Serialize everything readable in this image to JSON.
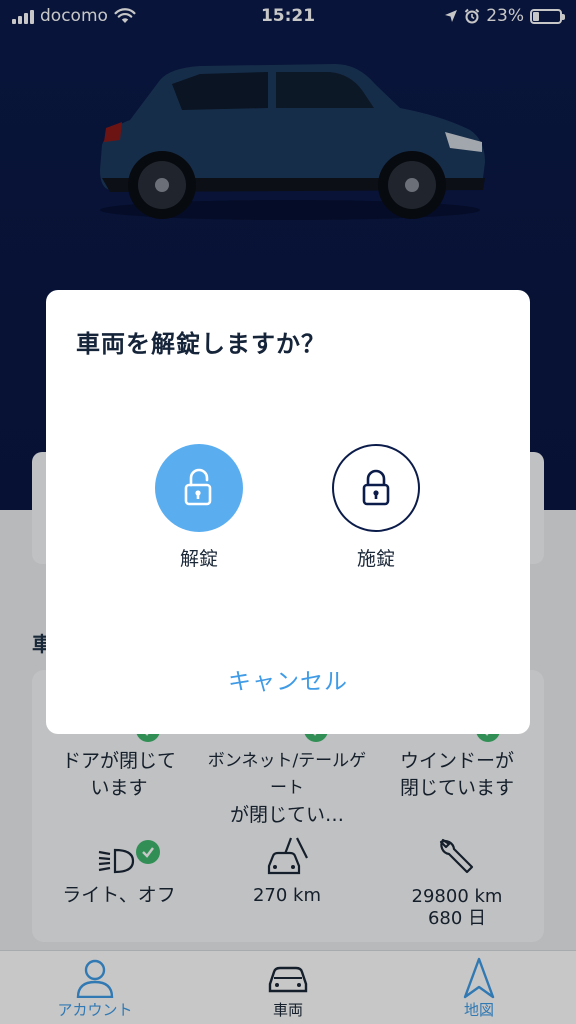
{
  "status_bar": {
    "carrier": "docomo",
    "time": "15:21",
    "battery": "23%",
    "battery_level": 0.23
  },
  "section": {
    "title_fragment": "車"
  },
  "status_items": [
    {
      "label": "ドアが閉じています",
      "line1": "ドアが閉じて",
      "line2": "います",
      "icon": "door-icon",
      "ok": true
    },
    {
      "label": "ボンネット/テールゲートが閉じてい…",
      "line1": "ボンネット/テールゲート",
      "line2": "が閉じてい…",
      "icon": "hood-icon",
      "ok": true
    },
    {
      "label": "ウインドーが閉じています",
      "line1": "ウインドーが",
      "line2": "閉じています",
      "icon": "window-icon",
      "ok": true
    },
    {
      "label": "ライト、オフ",
      "line1": "ライト、オフ",
      "line2": "",
      "icon": "headlight-icon",
      "ok": true
    },
    {
      "label": "270 km",
      "line1": "270 km",
      "line2": "",
      "icon": "range-road-icon",
      "ok": false
    },
    {
      "label": "29800 km 680 日",
      "line1": "29800 km",
      "line2": "680 日",
      "icon": "wrench-icon",
      "ok": false
    }
  ],
  "tabs": [
    {
      "label": "アカウント",
      "icon": "person-icon",
      "active": false
    },
    {
      "label": "車両",
      "icon": "car-icon",
      "active": true
    },
    {
      "label": "地図",
      "icon": "navigation-arrow-icon",
      "active": false
    }
  ],
  "dialog": {
    "title": "車両を解錠しますか？",
    "unlock_label": "解錠",
    "lock_label": "施錠",
    "cancel_label": "キャンセル"
  },
  "colors": {
    "hero": "#0b1a4a",
    "accent": "#3f9be6",
    "unlock": "#5aaef0",
    "check": "#3fb86e"
  }
}
